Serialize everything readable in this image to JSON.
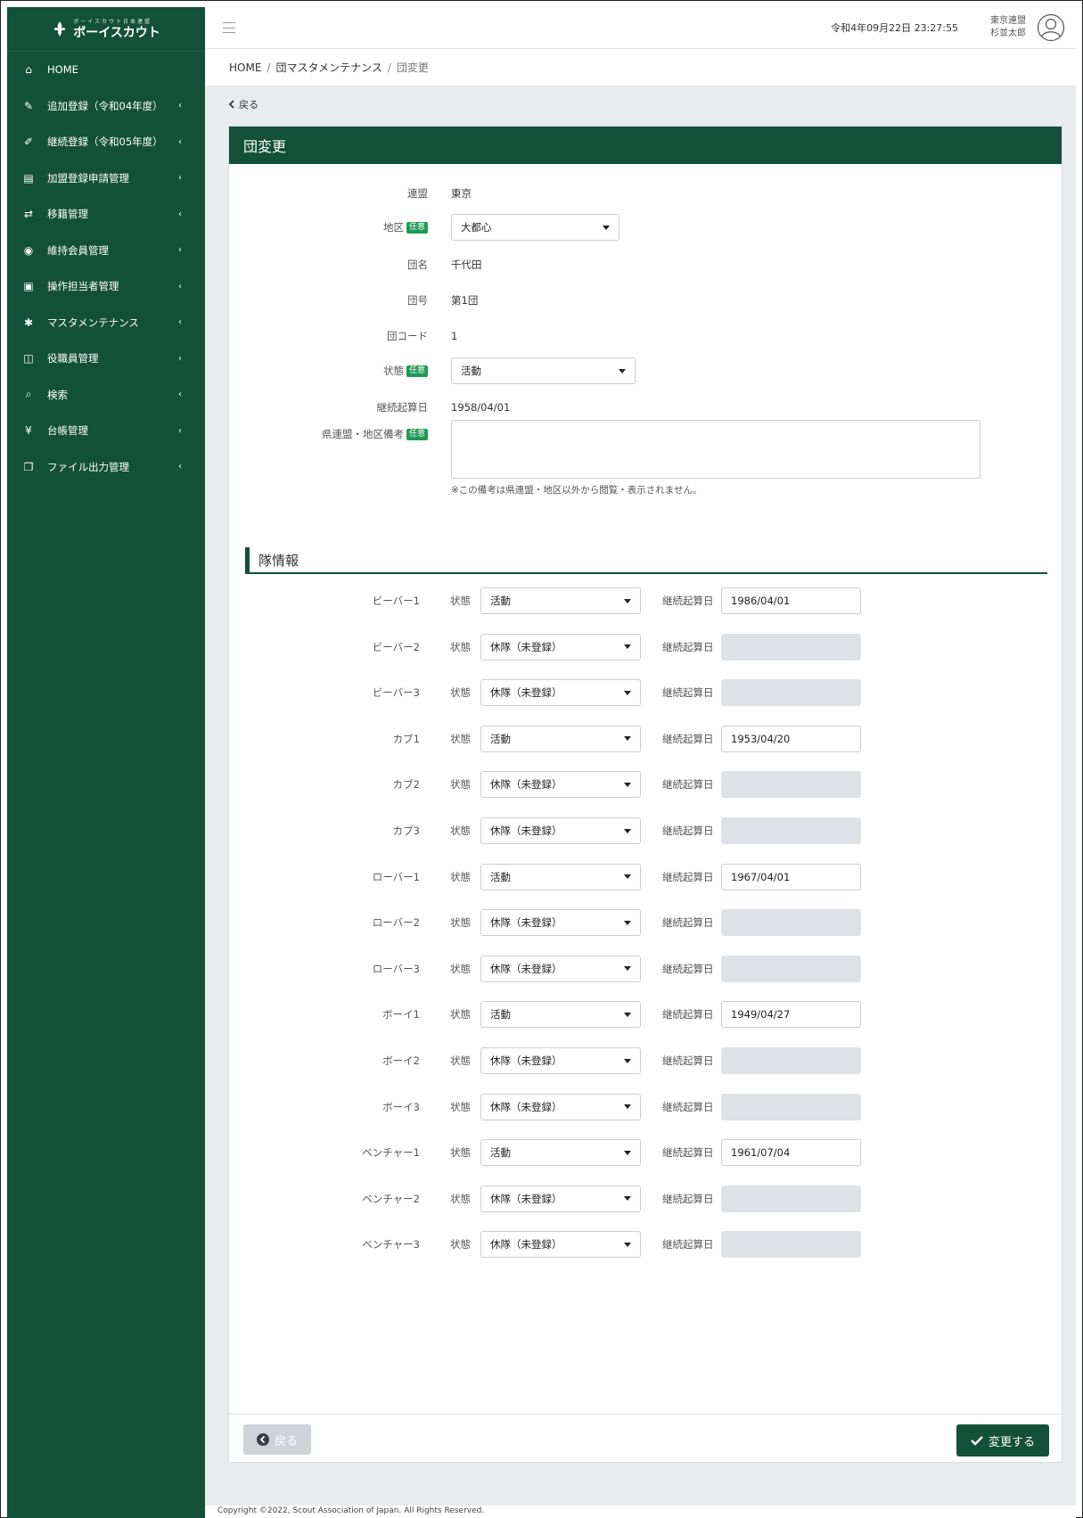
{
  "app": {
    "logo_sub": "ボーイスカウト日本連盟",
    "logo_main": "ボーイスカウト"
  },
  "sidebar": {
    "items": [
      {
        "label": "HOME",
        "icon": "home-icon",
        "chevron": false
      },
      {
        "label": "追加登録（令和04年度）",
        "icon": "edit-icon",
        "chevron": true
      },
      {
        "label": "継続登録（令和05年度）",
        "icon": "edit-outline-icon",
        "chevron": true
      },
      {
        "label": "加盟登録申請管理",
        "icon": "id-card-icon",
        "chevron": true
      },
      {
        "label": "移籍管理",
        "icon": "transfer-icon",
        "chevron": true
      },
      {
        "label": "維持会員管理",
        "icon": "member-icon",
        "chevron": true
      },
      {
        "label": "操作担当者管理",
        "icon": "operator-icon",
        "chevron": true
      },
      {
        "label": "マスタメンテナンス",
        "icon": "gear-icon",
        "chevron": true
      },
      {
        "label": "役職員管理",
        "icon": "officer-icon",
        "chevron": true
      },
      {
        "label": "検索",
        "icon": "search-icon",
        "chevron": true
      },
      {
        "label": "台帳管理",
        "icon": "yen-icon",
        "chevron": true
      },
      {
        "label": "ファイル出力管理",
        "icon": "file-output-icon",
        "chevron": true
      }
    ]
  },
  "header": {
    "datetime": "令和4年09月22日 23:27:55",
    "user_org": "東京連盟",
    "user_name": "杉並太郎"
  },
  "breadcrumb": {
    "home": "HOME",
    "sep": "/",
    "master": "団マスタメンテナンス",
    "current": "団変更"
  },
  "page": {
    "back_link": "戻る",
    "title": "団変更",
    "badge_optional": "任意"
  },
  "form": {
    "federation_label": "連盟",
    "federation_value": "東京",
    "district_label": "地区",
    "district_value": "大都心",
    "group_name_label": "団名",
    "group_name_value": "千代田",
    "group_no_label": "団号",
    "group_no_value": "第1団",
    "group_code_label": "団コード",
    "group_code_value": "1",
    "status_label": "状態",
    "status_value": "活動",
    "start_date_label": "継続起算日",
    "start_date_value": "1958/04/01",
    "remarks_label": "県連盟・地区備考",
    "remarks_value": "",
    "remarks_note": "※この備考は県連盟・地区以外から閲覧・表示されません。"
  },
  "units": {
    "section_title": "隊情報",
    "status_label": "状態",
    "date_label": "継続起算日",
    "rows": [
      {
        "name": "ビーバー1",
        "status": "活動",
        "date": "1986/04/01",
        "disabled": false
      },
      {
        "name": "ビーバー2",
        "status": "休隊（未登録）",
        "date": "",
        "disabled": true
      },
      {
        "name": "ビーバー3",
        "status": "休隊（未登録）",
        "date": "",
        "disabled": true
      },
      {
        "name": "カブ1",
        "status": "活動",
        "date": "1953/04/20",
        "disabled": false
      },
      {
        "name": "カブ2",
        "status": "休隊（未登録）",
        "date": "",
        "disabled": true
      },
      {
        "name": "カブ3",
        "status": "休隊（未登録）",
        "date": "",
        "disabled": true
      },
      {
        "name": "ローバー1",
        "status": "活動",
        "date": "1967/04/01",
        "disabled": false
      },
      {
        "name": "ローバー2",
        "status": "休隊（未登録）",
        "date": "",
        "disabled": true
      },
      {
        "name": "ローバー3",
        "status": "休隊（未登録）",
        "date": "",
        "disabled": true
      },
      {
        "name": "ボーイ1",
        "status": "活動",
        "date": "1949/04/27",
        "disabled": false
      },
      {
        "name": "ボーイ2",
        "status": "休隊（未登録）",
        "date": "",
        "disabled": true
      },
      {
        "name": "ボーイ3",
        "status": "休隊（未登録）",
        "date": "",
        "disabled": true
      },
      {
        "name": "ベンチャー1",
        "status": "活動",
        "date": "1961/07/04",
        "disabled": false
      },
      {
        "name": "ベンチャー2",
        "status": "休隊（未登録）",
        "date": "",
        "disabled": true
      },
      {
        "name": "ベンチャー3",
        "status": "休隊（未登録）",
        "date": "",
        "disabled": true
      }
    ]
  },
  "actions": {
    "back_label": "戻る",
    "submit_label": "変更する"
  },
  "footer": {
    "copyright": "Copyright ©2022, Scout Association of Japan. All Rights Reserved."
  },
  "colors": {
    "brand": "#13503a",
    "badge": "#1f9a56",
    "background": "#e9ecef",
    "disabled_input": "#dee1e5"
  }
}
